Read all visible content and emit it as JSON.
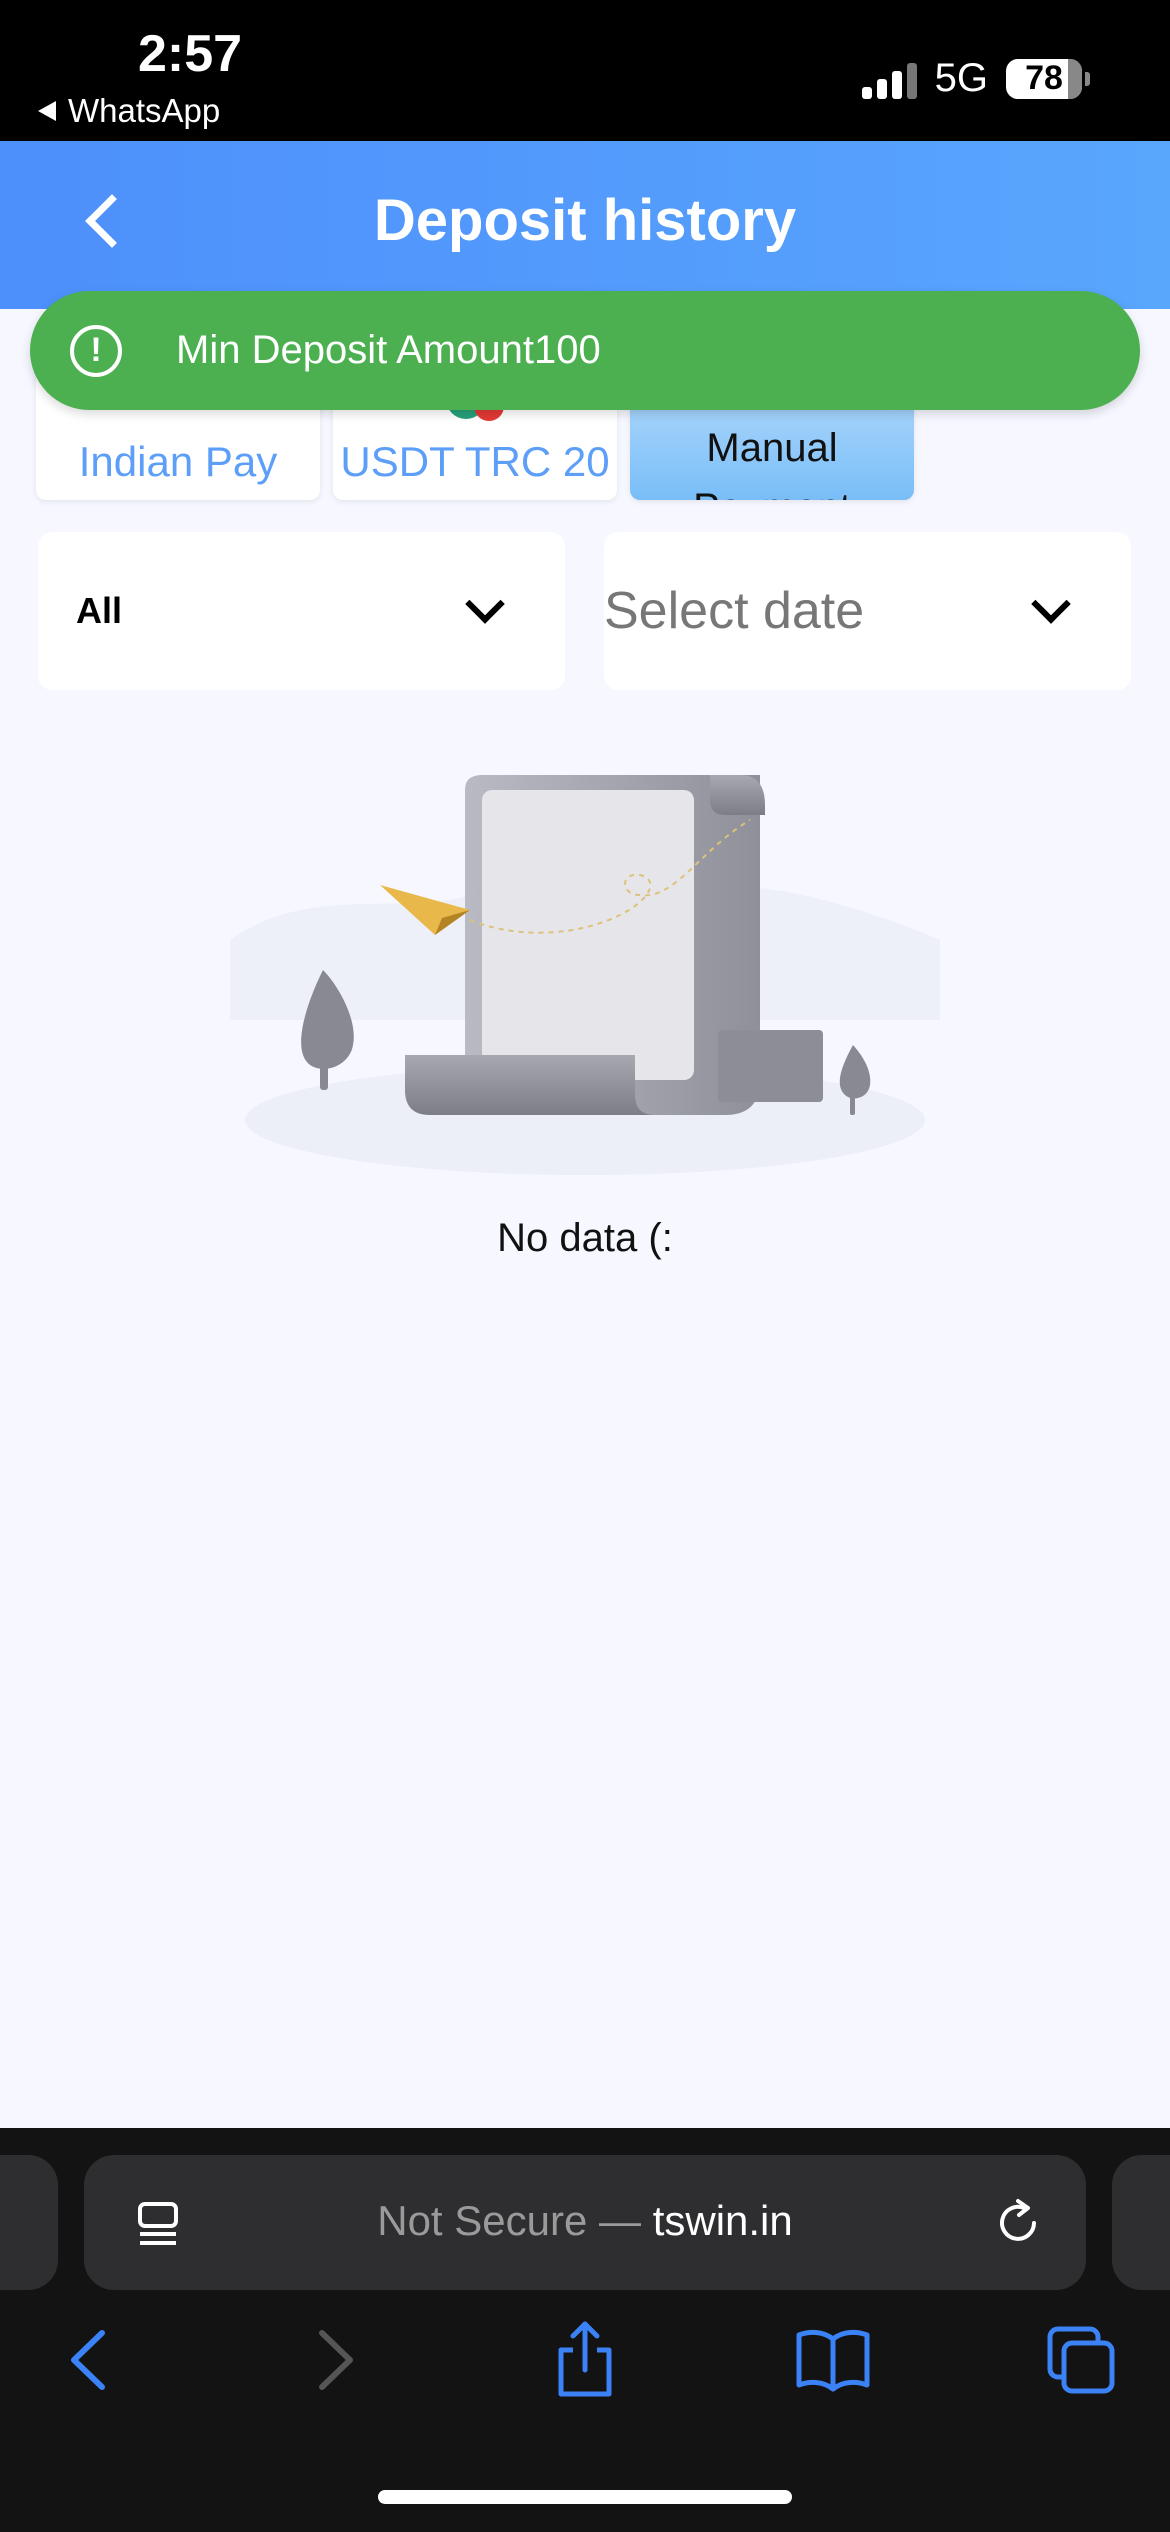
{
  "status": {
    "time": "2:57",
    "back_app": "WhatsApp",
    "network": "5G",
    "battery": "78"
  },
  "header": {
    "title": "Deposit history"
  },
  "toast": {
    "message": "Min Deposit Amount100"
  },
  "tabs": [
    {
      "label": "Indian Pay"
    },
    {
      "label": "USDT TRC 20"
    },
    {
      "label": "Manual Payment"
    }
  ],
  "filters": {
    "type_value": "All",
    "date_placeholder": "Select date"
  },
  "empty": {
    "message": "No data (:"
  },
  "browser": {
    "url_prefix": "Not Secure — ",
    "url_domain": "tswin.in"
  },
  "colors": {
    "header_start": "#4d8ffb",
    "header_end": "#59a6fd",
    "toast": "#4caf50",
    "tab_label": "#5d9ff8",
    "ios_blue": "#3b82f6"
  }
}
